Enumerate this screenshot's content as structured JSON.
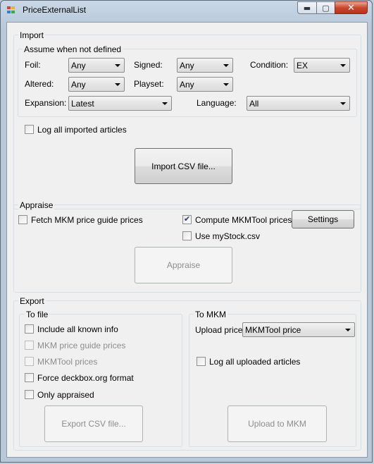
{
  "window": {
    "title": "PriceExternalList",
    "min_glyph": "▬",
    "max_glyph": "▢",
    "close_glyph": "✕"
  },
  "import": {
    "group_label": "Import",
    "assume_label": "Assume when not defined",
    "foil": {
      "label": "Foil:",
      "value": "Any"
    },
    "signed": {
      "label": "Signed:",
      "value": "Any"
    },
    "condition": {
      "label": "Condition:",
      "value": "EX"
    },
    "altered": {
      "label": "Altered:",
      "value": "Any"
    },
    "playset": {
      "label": "Playset:",
      "value": "Any"
    },
    "expansion": {
      "label": "Expansion:",
      "value": "Latest"
    },
    "language": {
      "label": "Language:",
      "value": "All"
    },
    "log_label": "Log all imported articles",
    "import_button": "Import CSV file..."
  },
  "appraise": {
    "group_label": "Appraise",
    "fetch_label": "Fetch MKM price guide prices",
    "compute_label": "Compute MKMTool prices",
    "compute_checked": true,
    "settings_button": "Settings",
    "mystock_label": "Use myStock.csv",
    "appraise_button": "Appraise"
  },
  "export": {
    "group_label": "Export",
    "to_file_label": "To file",
    "include_all": "Include all known info",
    "mkm_guide": "MKM price guide prices",
    "mkmtool_prices": "MKMTool prices",
    "force_deckbox": "Force deckbox.org format",
    "only_appraised": "Only appraised",
    "export_button": "Export CSV file...",
    "to_mkm_label": "To MKM",
    "upload_price_label": "Upload price:",
    "upload_price_value": "MKMTool price",
    "log_uploaded": "Log all uploaded articles",
    "upload_button": "Upload to MKM"
  },
  "colors": {
    "titlebar": "#c9d7e6",
    "close": "#c9472e",
    "client": "#f0f0f0",
    "check": "#2a3b6a"
  }
}
